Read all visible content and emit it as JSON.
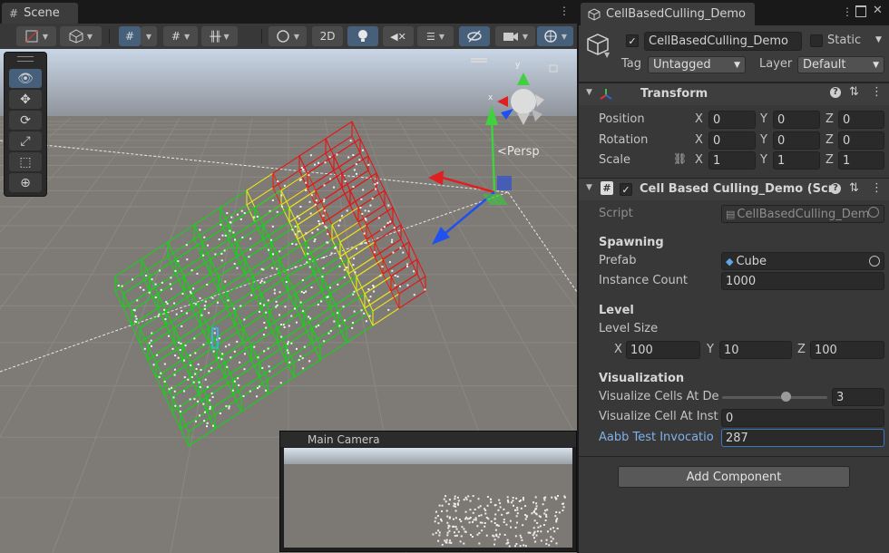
{
  "scene": {
    "tab_label": "Scene",
    "toolbar": {
      "mode_2d_label": "2D"
    },
    "persp_label": "<Persp",
    "camera_preview_title": "Main Camera"
  },
  "inspector": {
    "tab_label": "CellBasedCulling_Demo",
    "object": {
      "name": "CellBasedCulling_Demo",
      "active": true,
      "static_label": "Static",
      "tag_label": "Tag",
      "tag_value": "Untagged",
      "layer_label": "Layer",
      "layer_value": "Default"
    },
    "transform": {
      "title": "Transform",
      "rows": [
        {
          "label": "Position",
          "x": "0",
          "y": "0",
          "z": "0"
        },
        {
          "label": "Rotation",
          "x": "0",
          "y": "0",
          "z": "0"
        },
        {
          "label": "Scale",
          "x": "1",
          "y": "1",
          "z": "1"
        }
      ],
      "x_label": "X",
      "y_label": "Y",
      "z_label": "Z"
    },
    "script_component": {
      "title": "Cell Based Culling_Demo (Scri",
      "script_label": "Script",
      "script_value": "CellBasedCulling_Dem",
      "spawning_header": "Spawning",
      "prefab_label": "Prefab",
      "prefab_value": "Cube",
      "instance_count_label": "Instance Count",
      "instance_count_value": "1000",
      "level_header": "Level",
      "level_size_label": "Level Size",
      "level_x": "100",
      "level_y": "10",
      "level_z": "100",
      "visualization_header": "Visualization",
      "visualize_depth_label": "Visualize Cells At De",
      "visualize_depth_value": "3",
      "visualize_depth_slider_fraction": 0.6,
      "visualize_cell_label": "Visualize Cell At Inst",
      "visualize_cell_value": "0",
      "aabb_label": "Aabb Test Invocatio",
      "aabb_value": "287"
    },
    "add_component_label": "Add Component"
  },
  "colors": {
    "accent_blue": "#46607c",
    "cell_green": "#18d018",
    "cell_yellow": "#e8e020",
    "cell_red": "#e01818",
    "axis_x": "#e02020",
    "axis_y": "#40d040",
    "axis_z": "#2050f0"
  }
}
